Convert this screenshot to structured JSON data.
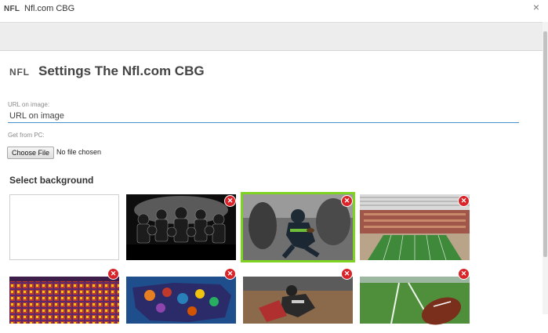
{
  "window": {
    "logo": "NFL",
    "title": "Nfl.com CBG",
    "close_glyph": "×"
  },
  "header": {
    "logo": "NFL",
    "title": "Settings The Nfl.com CBG"
  },
  "url_field": {
    "label": "URL on image:",
    "placeholder": "URL on image"
  },
  "file_field": {
    "label": "Get from PC:",
    "button_label": "Choose File",
    "status": "No file chosen"
  },
  "backgrounds": {
    "title": "Select background",
    "items": [
      {
        "name": "empty",
        "selected": false,
        "removable": false
      },
      {
        "name": "team-huddle",
        "selected": false,
        "removable": true
      },
      {
        "name": "running-back",
        "selected": true,
        "removable": true
      },
      {
        "name": "stadium",
        "selected": false,
        "removable": true
      },
      {
        "name": "helmets-grid",
        "selected": false,
        "removable": true
      },
      {
        "name": "team-map",
        "selected": false,
        "removable": true
      },
      {
        "name": "tackle",
        "selected": false,
        "removable": true
      },
      {
        "name": "football-field",
        "selected": false,
        "removable": true
      }
    ],
    "delete_glyph": "✕"
  },
  "colors": {
    "accent_selected": "#7ed321",
    "delete": "#d9252a",
    "input_underline": "#4a90c8"
  }
}
